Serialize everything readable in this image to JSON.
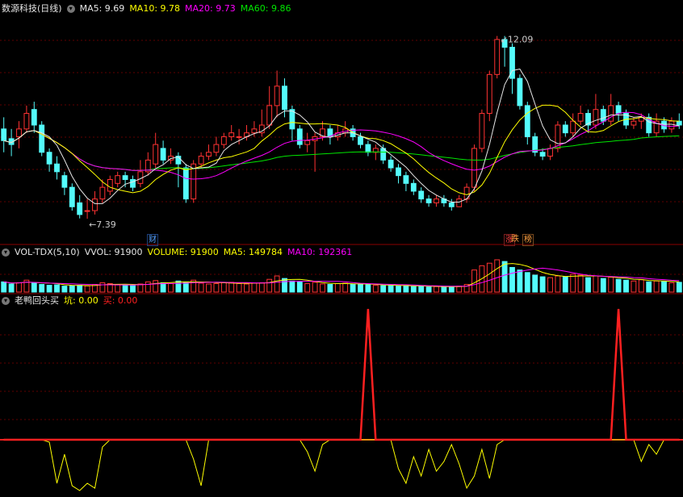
{
  "header": {
    "title": "数源科技(日线)",
    "ma5": "MA5: 9.69",
    "ma10": "MA10: 9.78",
    "ma20": "MA20: 9.73",
    "ma60": "MA60: 9.86"
  },
  "colors": {
    "up": "#ff3232",
    "down": "#54fcfc",
    "ma5": "#e6e6e6",
    "ma10": "#ffff00",
    "ma20": "#ff00ff",
    "ma60": "#00e600",
    "grid": "#600000",
    "signal": "#ff2020",
    "flow": "#ffff00"
  },
  "price_annotations": {
    "high": "12.09",
    "low": "7.39"
  },
  "badges": {
    "cai": "财",
    "die": "跌",
    "bang": "榜",
    "zhang": "涨"
  },
  "vol_header": {
    "name": "VOL-TDX(5,10)",
    "vvol": "VVOL: 91900",
    "volume": "VOLUME: 91900",
    "ma5": "MA5: 149784",
    "ma10": "MA10: 192361"
  },
  "ind_header": {
    "name": "老鸭回头买",
    "kang": "坑: 0.00",
    "mai": "买: 0.00"
  },
  "chart_data": [
    {
      "type": "candlestick",
      "title": "数源科技(日线)",
      "ohlc": [
        [
          9.7,
          9.4,
          10.0,
          9.1
        ],
        [
          9.45,
          9.3,
          9.7,
          9.0
        ],
        [
          9.5,
          9.7,
          9.9,
          9.2
        ],
        [
          9.7,
          10.1,
          10.3,
          9.6
        ],
        [
          10.2,
          9.8,
          10.4,
          9.6
        ],
        [
          9.8,
          9.1,
          9.9,
          9.0
        ],
        [
          9.1,
          8.8,
          9.2,
          8.6
        ],
        [
          8.8,
          8.6,
          9.0,
          8.4
        ],
        [
          8.5,
          8.2,
          8.6,
          8.0
        ],
        [
          8.2,
          7.7,
          8.3,
          7.6
        ],
        [
          7.8,
          7.5,
          8.0,
          7.4
        ],
        [
          7.6,
          7.6,
          7.9,
          7.39
        ],
        [
          7.6,
          7.9,
          8.1,
          7.5
        ],
        [
          7.9,
          8.2,
          8.4,
          7.8
        ],
        [
          8.1,
          8.4,
          8.5,
          8.0
        ],
        [
          8.3,
          8.5,
          8.6,
          8.2
        ],
        [
          8.5,
          8.4,
          8.6,
          8.2
        ],
        [
          8.4,
          8.2,
          8.5,
          8.1
        ],
        [
          8.3,
          8.6,
          8.9,
          8.2
        ],
        [
          8.6,
          8.9,
          9.1,
          8.5
        ],
        [
          8.8,
          9.3,
          9.6,
          8.7
        ],
        [
          9.2,
          8.9,
          9.4,
          8.8
        ],
        [
          8.9,
          9.0,
          9.2,
          8.8
        ],
        [
          9.0,
          8.8,
          9.1,
          8.2
        ],
        [
          8.7,
          7.9,
          8.8,
          7.8
        ],
        [
          7.9,
          8.8,
          8.9,
          7.8
        ],
        [
          8.8,
          9.0,
          9.1,
          8.7
        ],
        [
          9.0,
          9.1,
          9.3,
          8.9
        ],
        [
          9.1,
          9.3,
          9.5,
          9.0
        ],
        [
          9.3,
          9.5,
          9.6,
          9.2
        ],
        [
          9.5,
          9.6,
          9.8,
          9.4
        ],
        [
          9.5,
          9.5,
          9.7,
          9.3
        ],
        [
          9.5,
          9.6,
          9.8,
          9.4
        ],
        [
          9.6,
          9.7,
          9.9,
          9.5
        ],
        [
          9.6,
          9.8,
          10.2,
          9.5
        ],
        [
          9.8,
          10.3,
          10.8,
          9.7
        ],
        [
          10.3,
          10.8,
          11.2,
          10.0
        ],
        [
          10.8,
          10.2,
          11.0,
          10.0
        ],
        [
          10.2,
          9.7,
          10.3,
          9.4
        ],
        [
          9.7,
          9.3,
          9.8,
          9.2
        ],
        [
          9.3,
          9.4,
          9.6,
          9.1
        ],
        [
          9.4,
          9.5,
          9.6,
          8.6
        ],
        [
          9.5,
          9.7,
          9.9,
          9.4
        ],
        [
          9.7,
          9.5,
          9.8,
          9.3
        ],
        [
          9.5,
          9.6,
          9.8,
          9.4
        ],
        [
          9.6,
          9.7,
          9.9,
          9.5
        ],
        [
          9.7,
          9.5,
          9.8,
          9.4
        ],
        [
          9.5,
          9.3,
          9.6,
          9.2
        ],
        [
          9.3,
          9.1,
          9.4,
          9.0
        ],
        [
          9.1,
          9.2,
          9.3,
          8.9
        ],
        [
          9.2,
          8.9,
          9.3,
          8.8
        ],
        [
          8.9,
          8.7,
          9.0,
          8.6
        ],
        [
          8.7,
          8.5,
          8.8,
          8.3
        ],
        [
          8.5,
          8.3,
          8.6,
          8.1
        ],
        [
          8.3,
          8.1,
          8.4,
          8.0
        ],
        [
          8.1,
          7.9,
          8.2,
          7.8
        ],
        [
          7.9,
          7.8,
          8.0,
          7.7
        ],
        [
          7.8,
          7.9,
          8.0,
          7.7
        ],
        [
          7.9,
          7.8,
          8.0,
          7.7
        ],
        [
          7.8,
          7.7,
          7.9,
          7.6
        ],
        [
          7.7,
          7.9,
          8.0,
          7.7
        ],
        [
          7.9,
          8.2,
          8.3,
          7.8
        ],
        [
          8.2,
          9.2,
          9.3,
          8.1
        ],
        [
          9.2,
          10.1,
          10.2,
          9.1
        ],
        [
          10.1,
          11.1,
          11.2,
          9.9
        ],
        [
          11.1,
          12.0,
          12.09,
          11.0
        ],
        [
          12.0,
          11.8,
          12.09,
          11.3
        ],
        [
          11.8,
          11.0,
          11.9,
          10.6
        ],
        [
          11.0,
          10.3,
          11.1,
          10.2
        ],
        [
          10.3,
          9.5,
          10.4,
          9.3
        ],
        [
          9.5,
          9.1,
          9.6,
          9.0
        ],
        [
          9.1,
          9.0,
          9.2,
          8.9
        ],
        [
          9.0,
          9.2,
          9.3,
          8.9
        ],
        [
          9.2,
          9.8,
          9.9,
          9.1
        ],
        [
          9.8,
          9.6,
          9.9,
          9.5
        ],
        [
          9.6,
          9.9,
          10.1,
          9.5
        ],
        [
          9.9,
          10.1,
          10.3,
          9.8
        ],
        [
          10.1,
          9.8,
          10.2,
          9.6
        ],
        [
          9.8,
          10.2,
          10.6,
          9.7
        ],
        [
          10.2,
          9.9,
          10.3,
          9.8
        ],
        [
          9.9,
          10.3,
          10.6,
          9.8
        ],
        [
          10.3,
          10.1,
          10.4,
          9.9
        ],
        [
          10.1,
          9.8,
          10.2,
          9.7
        ],
        [
          9.8,
          9.9,
          10.0,
          9.7
        ],
        [
          9.9,
          10.0,
          10.1,
          9.7
        ],
        [
          10.0,
          9.6,
          10.1,
          9.5
        ],
        [
          9.6,
          9.9,
          10.1,
          9.5
        ],
        [
          9.9,
          9.7,
          10.0,
          9.6
        ],
        [
          9.7,
          9.9,
          10.0,
          9.6
        ],
        [
          9.9,
          9.8,
          10.1,
          9.7
        ]
      ],
      "ma5_last": 9.69,
      "ma10_last": 9.78,
      "ma20_last": 9.73,
      "ma60_last": 9.86,
      "high_label": 12.09,
      "low_label": 7.39,
      "ylim": [
        7.0,
        12.6
      ]
    },
    {
      "type": "bar",
      "title": "VOL-TDX(5,10)",
      "series_values": [
        120,
        95,
        110,
        140,
        105,
        90,
        80,
        85,
        70,
        75,
        80,
        72,
        90,
        110,
        100,
        85,
        80,
        75,
        95,
        120,
        135,
        110,
        100,
        130,
        120,
        140,
        105,
        95,
        100,
        110,
        115,
        100,
        95,
        105,
        110,
        150,
        190,
        160,
        130,
        120,
        100,
        115,
        95,
        90,
        100,
        105,
        95,
        90,
        85,
        80,
        75,
        85,
        70,
        75,
        65,
        70,
        60,
        65,
        62,
        60,
        70,
        90,
        260,
        310,
        340,
        380,
        360,
        290,
        260,
        230,
        200,
        180,
        170,
        190,
        180,
        210,
        200,
        170,
        190,
        160,
        175,
        150,
        140,
        130,
        145,
        120,
        130,
        125,
        110,
        115
      ],
      "vvol": 91900,
      "ma5": 149784,
      "ma10": 192361
    },
    {
      "type": "line",
      "title": "老鸭回头买",
      "flow_series": [
        0,
        0,
        0,
        0,
        0,
        0,
        -0.1,
        -1.8,
        -0.6,
        -1.9,
        -2.1,
        -1.8,
        -2.0,
        -0.3,
        0,
        0,
        0,
        0,
        0,
        0,
        0,
        0,
        0,
        0,
        0,
        -0.8,
        -1.9,
        0,
        0,
        0,
        0,
        0,
        0,
        0,
        0,
        0,
        0,
        0,
        0,
        0,
        -0.5,
        -1.3,
        -0.2,
        0,
        0,
        0,
        0,
        0,
        0,
        0,
        0,
        0,
        -1.2,
        -1.8,
        -0.7,
        -1.5,
        -0.4,
        -1.3,
        -0.9,
        -0.2,
        -1.0,
        -2.0,
        -1.5,
        -0.4,
        -1.6,
        -0.2,
        0,
        0,
        0,
        0,
        0,
        0,
        0,
        0,
        0,
        0,
        0,
        0,
        0,
        0,
        0,
        0,
        0,
        0,
        -0.9,
        -0.2,
        -0.6,
        0,
        0,
        0
      ],
      "signal_series": [
        0,
        0,
        0,
        0,
        0,
        0,
        0,
        0,
        0,
        0,
        0,
        0,
        0,
        0,
        0,
        0,
        0,
        0,
        0,
        0,
        0,
        0,
        0,
        0,
        0,
        0,
        0,
        0,
        0,
        0,
        0,
        0,
        0,
        0,
        0,
        0,
        0,
        0,
        0,
        0,
        0,
        0,
        0,
        0,
        0,
        0,
        0,
        0,
        1,
        0,
        0,
        0,
        0,
        0,
        0,
        0,
        0,
        0,
        0,
        0,
        0,
        0,
        0,
        0,
        0,
        0,
        0,
        0,
        0,
        0,
        0,
        0,
        0,
        0,
        0,
        0,
        0,
        0,
        0,
        0,
        0,
        1,
        0,
        0,
        0,
        0,
        0,
        0,
        0,
        0
      ],
      "kang": 0.0,
      "mai": 0.0
    }
  ]
}
